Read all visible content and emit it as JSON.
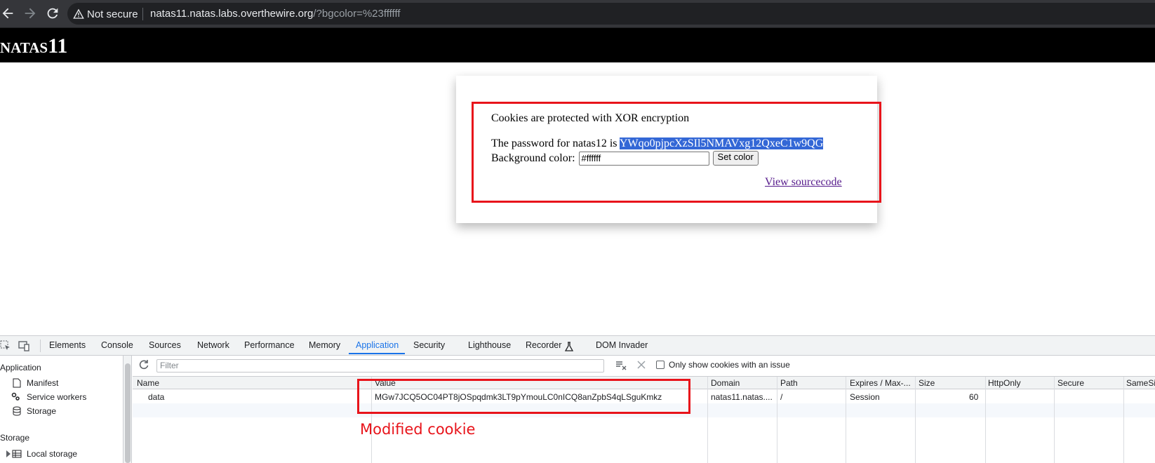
{
  "browser": {
    "security_label": "Not secure",
    "url_host": "natas11.natas.labs.overthewire.org",
    "url_rest": "/?bgcolor=%23ffffff"
  },
  "page": {
    "title": "natas11",
    "line1": "Cookies are protected with XOR encryption",
    "line2_prefix": "The password for natas12 is ",
    "password": "YWqo0pjpcXzSIl5NMAVxg12QxeC1w9QG",
    "bg_label": "Background color:",
    "bg_value": "#ffffff",
    "set_button": "Set color",
    "view_source": "View sourcecode"
  },
  "devtools": {
    "tabs": [
      "Elements",
      "Console",
      "Sources",
      "Network",
      "Performance",
      "Memory",
      "Application",
      "Security",
      "Lighthouse",
      "Recorder",
      "DOM Invader"
    ],
    "active_tab": "Application",
    "sidebar": {
      "application_header": "Application",
      "items": [
        "Manifest",
        "Service workers",
        "Storage"
      ],
      "storage_header": "Storage",
      "local_storage": "Local storage"
    },
    "filter_placeholder": "Filter",
    "issue_checkbox_label": "Only show cookies with an issue",
    "columns": [
      "Name",
      "Value",
      "Domain",
      "Path",
      "Expires / Max-...",
      "Size",
      "HttpOnly",
      "Secure",
      "SameSi"
    ],
    "row": {
      "name": "data",
      "value": "MGw7JCQ5OC04PT8jOSpqdmk3LT9pYmouLC0nICQ8anZpbS4qLSguKmkz",
      "domain": "natas11.natas....",
      "path": "/",
      "expires": "Session",
      "size": "60"
    }
  },
  "annotation": "Modified cookie",
  "colors": {
    "annotation_red": "#e8141b",
    "accent_blue": "#1a73e8",
    "selection_blue": "#3367d6"
  }
}
